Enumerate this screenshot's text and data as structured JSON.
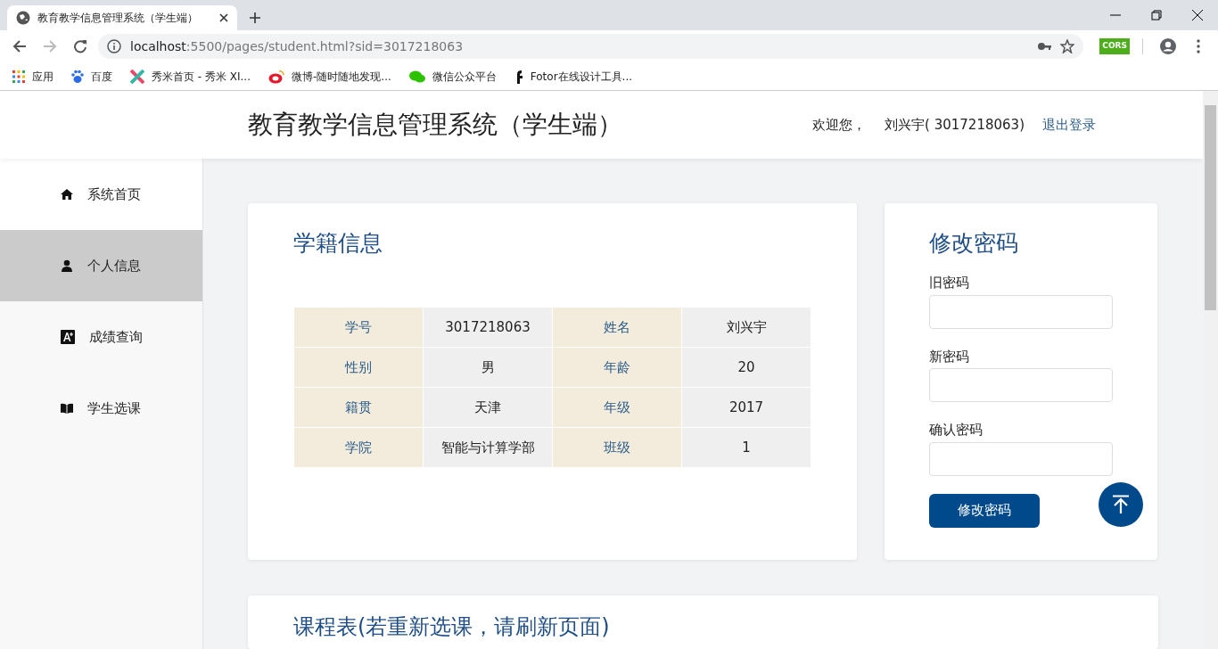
{
  "browser": {
    "tab_title": "教育教学信息管理系统（学生端）",
    "url_host": "localhost",
    "url_rest": ":5500/pages/student.html?sid=3017218063",
    "bookmarks": [
      "应用",
      "百度",
      "秀米首页 - 秀米 XI...",
      "微博-随时随地发现...",
      "微信公众平台",
      "Fotor在线设计工具..."
    ],
    "extension_label": "CORS"
  },
  "header": {
    "title": "教育教学信息管理系统（学生端）",
    "welcome": "欢迎您，",
    "user": "刘兴宇( 3017218063)",
    "logout": "退出登录"
  },
  "sidebar": {
    "items": [
      {
        "label": "系统首页",
        "selected": false
      },
      {
        "label": "个人信息",
        "selected": true
      },
      {
        "label": "成绩查询",
        "selected": false
      },
      {
        "label": "学生选课",
        "selected": false
      }
    ]
  },
  "student_info": {
    "title": "学籍信息",
    "rows": [
      [
        {
          "label": "学号",
          "value": "3017218063"
        },
        {
          "label": "姓名",
          "value": "刘兴宇"
        }
      ],
      [
        {
          "label": "性别",
          "value": "男"
        },
        {
          "label": "年龄",
          "value": "20"
        }
      ],
      [
        {
          "label": "籍贯",
          "value": "天津"
        },
        {
          "label": "年级",
          "value": "2017"
        }
      ],
      [
        {
          "label": "学院",
          "value": "智能与计算学部"
        },
        {
          "label": "班级",
          "value": "1"
        }
      ]
    ]
  },
  "password": {
    "title": "修改密码",
    "fields": [
      {
        "label": "旧密码"
      },
      {
        "label": "新密码"
      },
      {
        "label": "确认密码"
      }
    ],
    "button": "修改密码"
  },
  "schedule": {
    "title": "课程表(若重新选课，请刷新页面)"
  }
}
